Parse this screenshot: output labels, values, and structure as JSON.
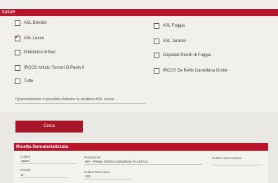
{
  "section_title": "Salute",
  "options": [
    {
      "label": "ASL Brindisi",
      "checked": false
    },
    {
      "label": "ASL Foggia",
      "checked": false
    },
    {
      "label": "ASL Lecce",
      "checked": true
    },
    {
      "label": "ASL Taranto",
      "checked": false
    },
    {
      "label": "Policlinico di Bari",
      "checked": false
    },
    {
      "label": "Ospedali Riuniti di Foggia",
      "checked": false
    },
    {
      "label": "IRCCS Istituto Tumori G.Paolo II",
      "checked": false
    },
    {
      "label": "IRCCS De Bellis Castellana Grotte",
      "checked": false
    },
    {
      "label": "Tutte",
      "checked": false
    }
  ],
  "note": "Opzionalmente è possibile indicare la struttura ASL Lecce",
  "search_button": "Cerca",
  "ricetta": {
    "title": "Ricetta Dematerializzata",
    "codice_label": "Codice",
    "codice_value": "16167",
    "prestazione_label": "Prestazione",
    "prestazione_value": "897 - PRIMA VISITA CHIRURGIA PLASTICA",
    "codice_nomenclatore_label": "Codice nomenclatore",
    "codice_nomenclatore_value": "",
    "priorita_label": "Priorità",
    "priorita_value": "D",
    "codice_esenzione_label": "Codice Esenzione",
    "codice_esenzione_value": "C01"
  },
  "colors": {
    "accent": "#b8152a",
    "background": "#f1f0ed"
  }
}
